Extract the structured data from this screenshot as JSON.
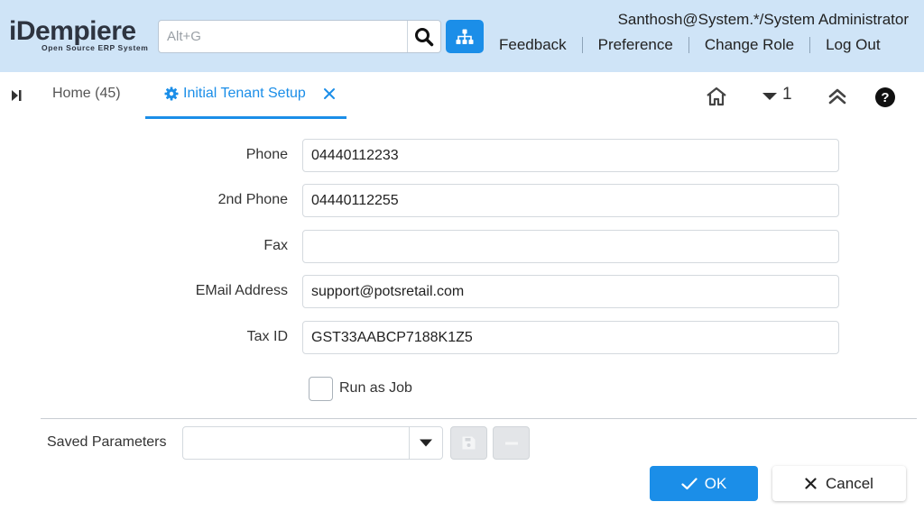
{
  "header": {
    "logo_text": "iDempiere",
    "logo_tagline": "Open Source ERP System",
    "search_placeholder": "Alt+G",
    "user_label": "Santhosh@System.*/System Administrator",
    "links": [
      "Feedback",
      "Preference",
      "Change Role",
      "Log Out"
    ]
  },
  "tabs": {
    "home_label": "Home (45)",
    "active_label": "Initial Tenant Setup",
    "dropdown_count": "1",
    "help_glyph": "?"
  },
  "form": {
    "fields": [
      {
        "label": "Phone",
        "value": "04440112233"
      },
      {
        "label": "2nd Phone",
        "value": "04440112255"
      },
      {
        "label": "Fax",
        "value": ""
      },
      {
        "label": "EMail Address",
        "value": "support@potsretail.com"
      },
      {
        "label": "Tax ID",
        "value": "GST33AABCP7188K1Z5"
      }
    ],
    "run_as_job_label": "Run as Job",
    "run_as_job_checked": false
  },
  "footer": {
    "saved_parameters_label": "Saved Parameters",
    "saved_parameters_value": "",
    "ok_label": "OK",
    "cancel_label": "Cancel"
  },
  "colors": {
    "header_bg": "#cfe4f7",
    "accent": "#1b8ee8"
  },
  "icons": [
    "search-icon",
    "tree-icon",
    "collapse-icon",
    "gear-icon",
    "close-icon",
    "home-icon",
    "chevron-down-icon",
    "double-chevron-up-icon",
    "help-icon",
    "save-icon",
    "minus-icon",
    "check-icon"
  ]
}
